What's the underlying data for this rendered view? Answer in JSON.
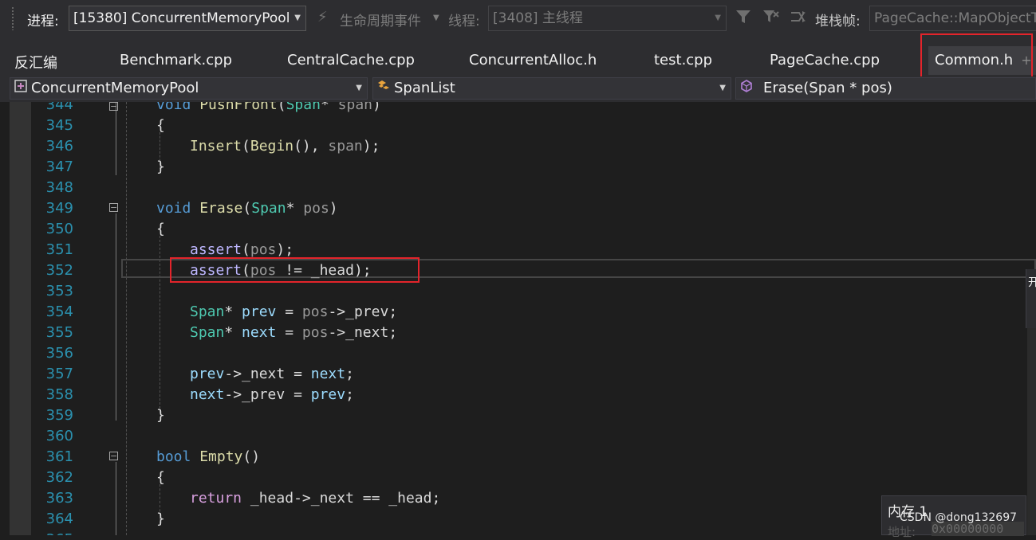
{
  "toolbar": {
    "process_label": "进程:",
    "process_value": "[15380] ConcurrentMemoryPool",
    "lifecycle_label": "生命周期事件",
    "thread_label": "线程:",
    "thread_value": "[3408] 主线程",
    "stack_label": "堆栈帧:",
    "stack_value": "PageCache::MapObjectToSpan"
  },
  "tabs": [
    {
      "label": "反汇编"
    },
    {
      "label": "Benchmark.cpp"
    },
    {
      "label": "CentralCache.cpp"
    },
    {
      "label": "ConcurrentAlloc.h"
    },
    {
      "label": "test.cpp"
    },
    {
      "label": "PageCache.cpp"
    },
    {
      "label": "Common.h",
      "active": true
    }
  ],
  "tab_add_symbol": "+",
  "navigation": {
    "project": "ConcurrentMemoryPool",
    "class": "SpanList",
    "member": "Erase(Span * pos)"
  },
  "code": {
    "lines": [
      {
        "n": "344",
        "text": "void PushFront(Span* span)"
      },
      {
        "n": "345",
        "text": "{"
      },
      {
        "n": "346",
        "text": "Insert(Begin(), span);"
      },
      {
        "n": "347",
        "text": "}"
      },
      {
        "n": "348",
        "text": ""
      },
      {
        "n": "349",
        "text": "void Erase(Span* pos)"
      },
      {
        "n": "350",
        "text": "{"
      },
      {
        "n": "351",
        "text": "assert(pos);"
      },
      {
        "n": "352",
        "text": "assert(pos != _head);"
      },
      {
        "n": "353",
        "text": ""
      },
      {
        "n": "354",
        "text": "Span* prev = pos->_prev;"
      },
      {
        "n": "355",
        "text": "Span* next = pos->_next;"
      },
      {
        "n": "356",
        "text": ""
      },
      {
        "n": "357",
        "text": "prev->_next = next;"
      },
      {
        "n": "358",
        "text": "next->_prev = prev;"
      },
      {
        "n": "359",
        "text": "}"
      },
      {
        "n": "360",
        "text": ""
      },
      {
        "n": "361",
        "text": "bool Empty()"
      },
      {
        "n": "362",
        "text": "{"
      },
      {
        "n": "363",
        "text": "return _head->_next == _head;"
      },
      {
        "n": "364",
        "text": "}"
      },
      {
        "n": "365",
        "text": ""
      }
    ]
  },
  "side_tab_label": "开",
  "memory_window": {
    "title": "内存 1",
    "address_label": "地址:",
    "address_value": "0x00000000"
  },
  "watermark": "CSDN @dong132697",
  "colors": {
    "background": "#1e1e1e",
    "keyword": "#569cd6",
    "type": "#4ec9b0",
    "function": "#dcdcaa",
    "macro": "#beb7ff",
    "line_number": "#2b91af",
    "highlight_box": "#e3242b"
  },
  "icons": [
    "lifecycle-events-icon",
    "filter-icon",
    "filter-clear-icon",
    "toggle-flag-icon",
    "class-icon",
    "method-icon",
    "project-icon",
    "fold-minus-icon"
  ]
}
